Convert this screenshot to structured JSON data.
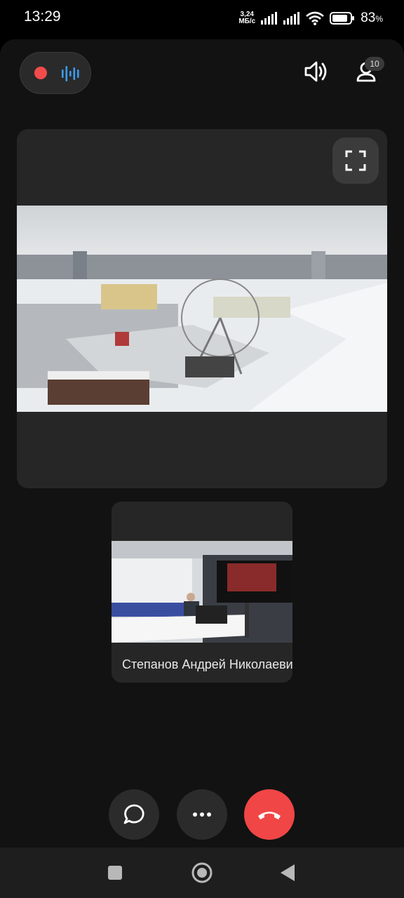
{
  "status_bar": {
    "time": "13:29",
    "net_speed_value": "3,24",
    "net_speed_unit": "МБ/с",
    "battery_percent": "83",
    "battery_symbol": "%",
    "icons": [
      "signal-icon",
      "signal-icon",
      "wifi-icon",
      "battery-icon"
    ]
  },
  "call": {
    "recording": true,
    "participants_count": "10",
    "main_video": {
      "description_icon": "video-feed",
      "kind": "screen-share"
    },
    "participants": [
      {
        "name": "Степанов Андрей Николаевич"
      }
    ]
  },
  "controls": {
    "chat_icon": "chat-icon",
    "more_icon": "more-icon",
    "end_icon": "end-call-icon"
  },
  "colors": {
    "accent_red": "#f04646",
    "record_red": "#f24b4b",
    "voice_blue": "#3b9cf0",
    "background": "#121212",
    "tile": "#262626"
  }
}
